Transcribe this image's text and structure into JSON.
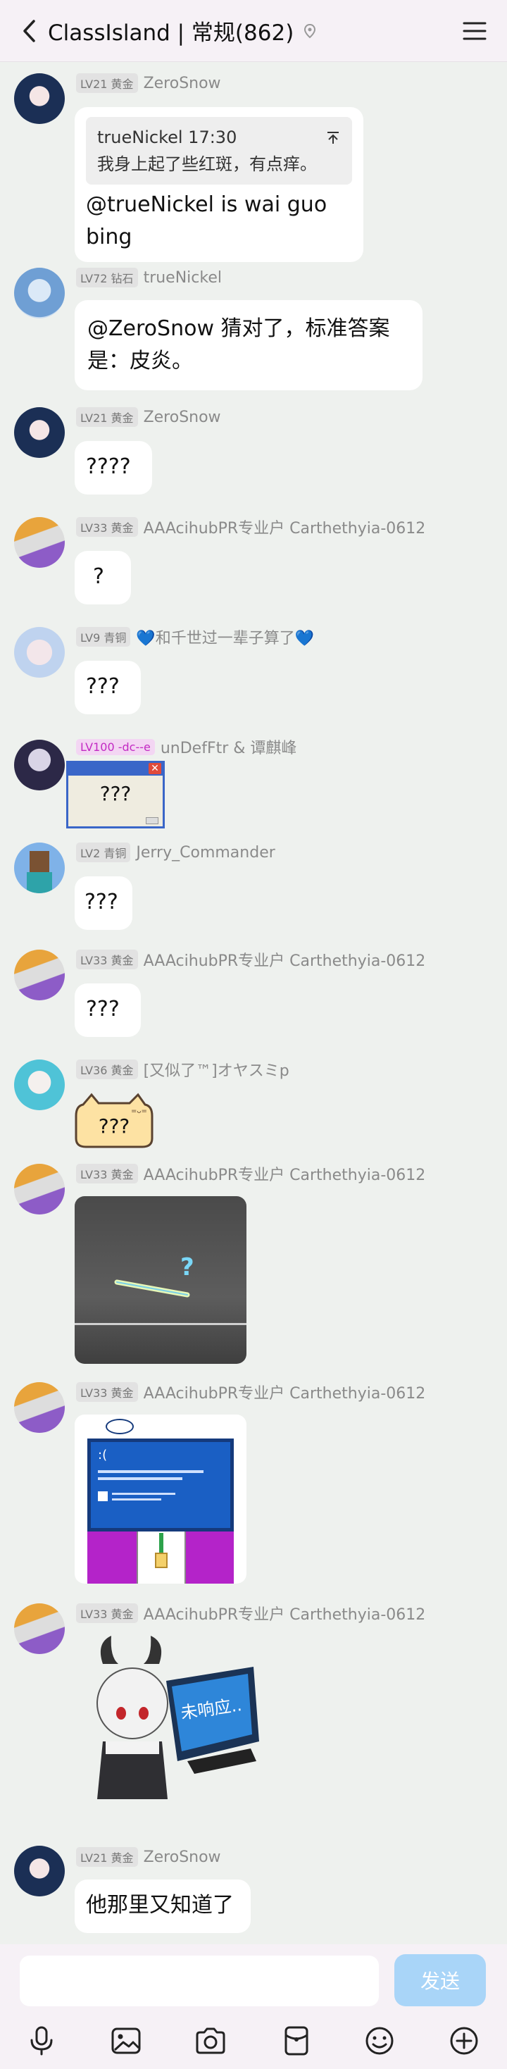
{
  "header": {
    "title": "ClassIsland | 常规(862)"
  },
  "messages": [
    {
      "level": "LV21 黄金",
      "nick": "ZeroSnow",
      "quote_author": "trueNickel 17:30",
      "quote_text": "我身上起了些红斑，有点痒。",
      "text": "@trueNickel is wai guo bing"
    },
    {
      "level": "LV72 钻石",
      "nick": "trueNickel",
      "text_line1": "@ZeroSnow 猜对了，标准答案",
      "text_line2": "是：皮炎。"
    },
    {
      "level": "LV21 黄金",
      "nick": "ZeroSnow",
      "text": "????"
    },
    {
      "level": "LV33 黄金",
      "nick": "AAAcihubPR专业户 Carthethyia-0612",
      "text": "?"
    },
    {
      "level": "LV9 青铜",
      "nick": "💙和千世过一辈子算了💙",
      "text": "???"
    },
    {
      "level": "LV100 -dc--e",
      "nick": "unDefFtr & 谭麒峰",
      "text": "???"
    },
    {
      "level": "LV2 青铜",
      "nick": "Jerry_Commander",
      "text": "???"
    },
    {
      "level": "LV33 黄金",
      "nick": "AAAcihubPR专业户 Carthethyia-0612",
      "text": "???"
    },
    {
      "level": "LV36 黄金",
      "nick": "[又似了™]オヤスミp",
      "text": "???"
    },
    {
      "level": "LV33 黄金",
      "nick": "AAAcihubPR专业户 Carthethyia-0612",
      "image": "sticker-light-bar"
    },
    {
      "level": "LV33 黄金",
      "nick": "AAAcihubPR专业户 Carthethyia-0612",
      "image": "sticker-bsod",
      "bsod_face": ":("
    },
    {
      "level": "LV33 黄金",
      "nick": "AAAcihubPR专业户 Carthethyia-0612",
      "image": "sticker-anime-monitor",
      "monitor_text": "未响应.."
    },
    {
      "level": "LV21 黄金",
      "nick": "ZeroSnow",
      "text": "他那里又知道了"
    }
  ],
  "composer": {
    "input_value": "",
    "send_label": "发送",
    "tools": [
      "microphone-icon",
      "image-icon",
      "camera-icon",
      "red-packet-icon",
      "emoji-icon",
      "plus-icon"
    ]
  },
  "colors": {
    "background": "#eef1ee",
    "header": "#f6f1f6",
    "send_disabled": "#a9d5f8"
  }
}
